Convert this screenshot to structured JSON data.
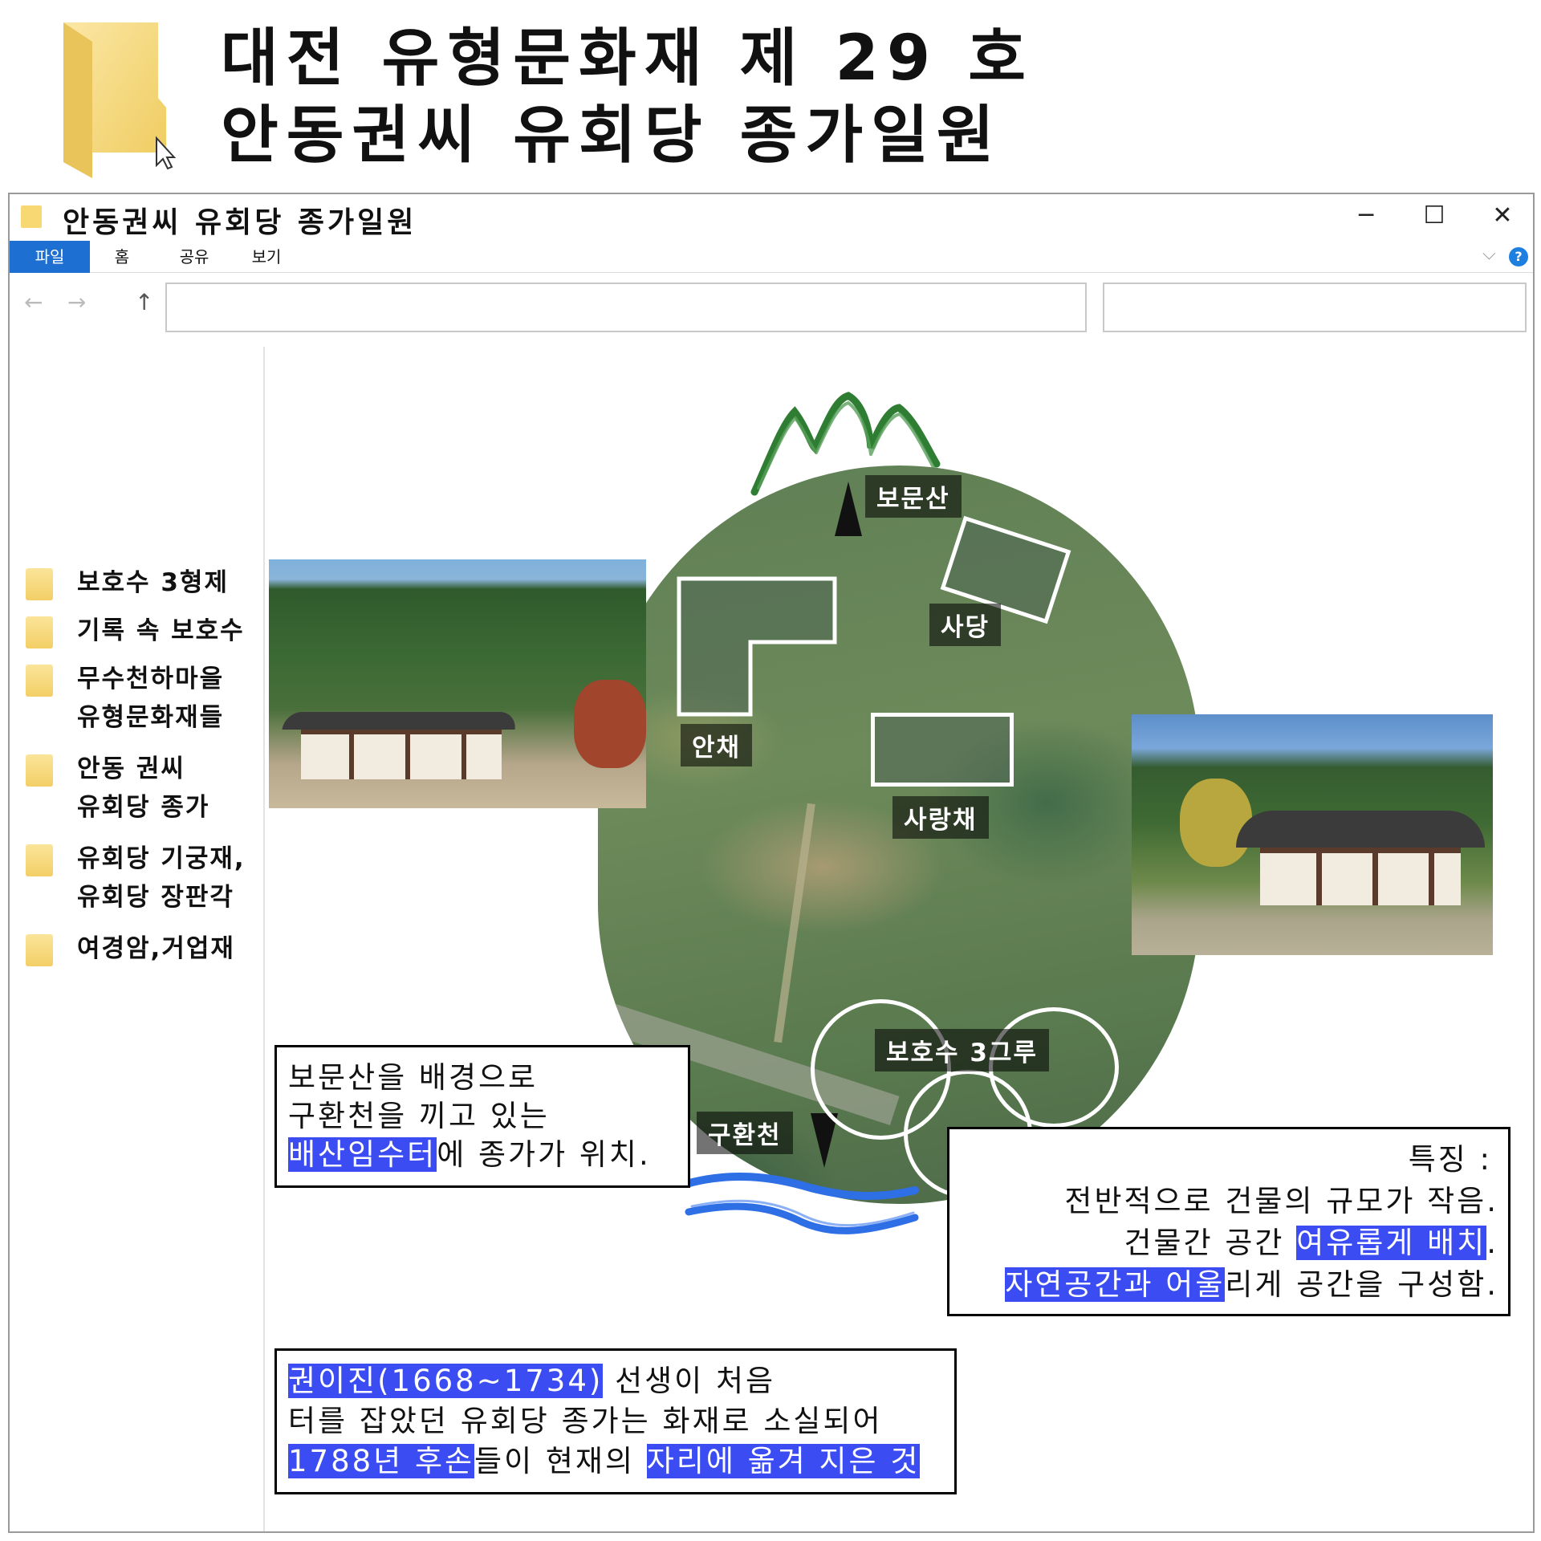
{
  "poster": {
    "title_line1": "대전 유형문화재 제 29 호",
    "title_line2": "안동권씨 유회당 종가일원"
  },
  "window": {
    "title": "안동권씨 유회당 종가일원",
    "minimize_icon": "─",
    "maximize_icon": "☐",
    "close_icon": "✕"
  },
  "ribbon": {
    "tabs": [
      "파일",
      "홈",
      "공유",
      "보기"
    ],
    "expand_icon": "⌵",
    "help_icon": "?"
  },
  "nav": {
    "back_icon": "←",
    "forward_icon": "→",
    "up_icon": "↑",
    "address": "",
    "search": ""
  },
  "sidebar": {
    "items": [
      "보호수 3형제",
      "기록 속 보호수",
      "무수천하마을\n유형문화재들",
      "안동 권씨\n유회당 종가",
      "유회당 기궁재,\n유회당 장판각",
      "여경암,거업재"
    ]
  },
  "map": {
    "labels": {
      "mountain": "보문산",
      "shrine": "사당",
      "inner_quarters": "안채",
      "sarangchae": "사랑채",
      "trees": "보호수 3그루",
      "stream": "구환천"
    }
  },
  "box1": {
    "line1": "보문산을 배경으로",
    "line2": "구환천을 끼고 있는",
    "line3_hl": "배산임수터",
    "line3_rest": "에 종가가 위치."
  },
  "box2": {
    "line1": "특징 :",
    "line2": "전반적으로 건물의 규모가 작음.",
    "line3_pre": "건물간 공간",
    "line3_hl": "여유롭게 배치",
    "line3_post": ".",
    "line4_hl": "자연공간과 어울",
    "line4_rest": "리게 공간을 구성함."
  },
  "box3": {
    "line1_hl": "권이진(1668~1734)",
    "line1_rest": " 선생이 처음",
    "line2": "터를 잡았던 유회당 종가는 화재로 소실되어",
    "line3_hl1": "1788년 후손",
    "line3_mid": "들이 현재의 ",
    "line3_hl2": "자리에 옮겨 지은 것"
  },
  "colors": {
    "highlight": "#3b4df2",
    "file_tab": "#1d6fd1",
    "mountain": "#2e7d32",
    "water": "#2f6fe6",
    "folder": "#f3cf65"
  }
}
